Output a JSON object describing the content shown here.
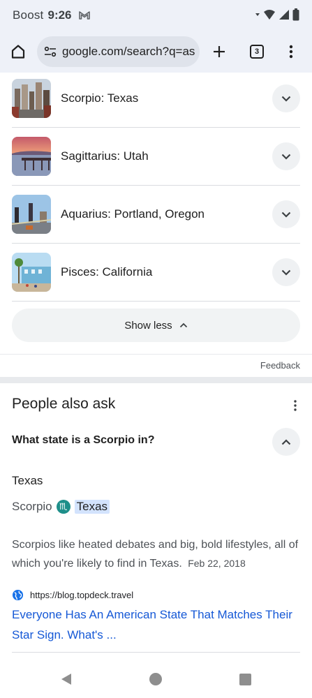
{
  "status_bar": {
    "carrier": "Boost",
    "time": "9:26"
  },
  "toolbar": {
    "url": "google.com/search?q=as",
    "tab_count": "3"
  },
  "states": [
    {
      "label": "Scorpio: Texas"
    },
    {
      "label": "Sagittarius: Utah"
    },
    {
      "label": "Aquarius: Portland, Oregon"
    },
    {
      "label": "Pisces: California"
    }
  ],
  "show_less_label": "Show less",
  "feedback_label": "Feedback",
  "people_also_ask": {
    "title": "People also ask",
    "question": "What state is a Scorpio in?",
    "answer": "Texas",
    "entity_from": "Scorpio",
    "entity_to": "Texas",
    "snippet": "Scorpios like heated debates and big, bold lifestyles, all of which you're likely to find in Texas.",
    "snippet_date": "Feb 22, 2018",
    "source_url": "https://blog.topdeck.travel",
    "link_text": "Everyone Has An American State That Matches Their Star Sign. What's ..."
  },
  "colors": {
    "link": "#1558d6",
    "zodiac": "#1e8f8a",
    "highlight": "#d3e3fd"
  }
}
